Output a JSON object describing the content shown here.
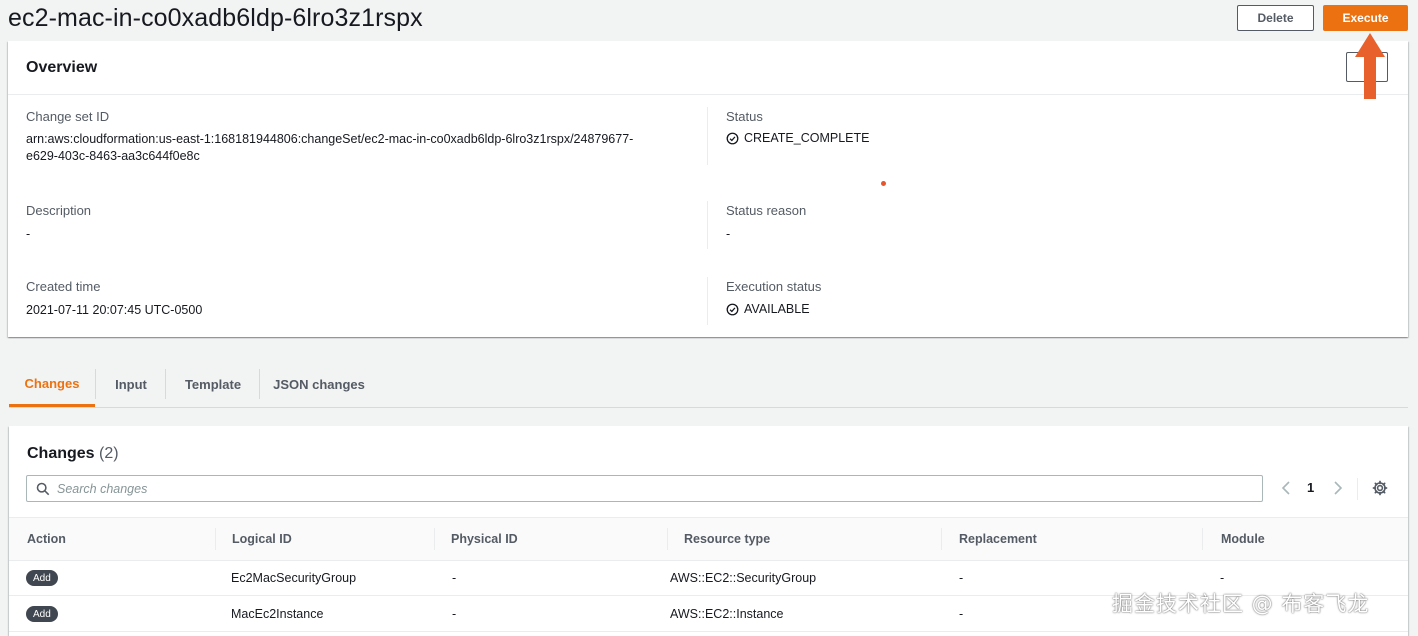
{
  "header": {
    "title": "ec2-mac-in-co0xadb6ldp-6lro3z1rspx",
    "delete_label": "Delete",
    "execute_label": "Execute"
  },
  "overview": {
    "title": "Overview",
    "change_set_id_label": "Change set ID",
    "change_set_id_value_line1": "arn:aws:cloudformation:us-east-1:168181944806:changeSet/ec2-mac-in-co0xadb6ldp-6lro3z1rspx/24879677-",
    "change_set_id_value_line2": "e629-403c-8463-aa3c644f0e8c",
    "description_label": "Description",
    "description_value": "-",
    "created_time_label": "Created time",
    "created_time_value": "2021-07-11 20:07:45 UTC-0500",
    "status_label": "Status",
    "status_value": "CREATE_COMPLETE",
    "status_reason_label": "Status reason",
    "status_reason_value": "-",
    "execution_status_label": "Execution status",
    "execution_status_value": "AVAILABLE"
  },
  "tabs": [
    {
      "label": "Changes",
      "active": true
    },
    {
      "label": "Input",
      "active": false
    },
    {
      "label": "Template",
      "active": false
    },
    {
      "label": "JSON changes",
      "active": false
    }
  ],
  "changes": {
    "title": "Changes",
    "count": "(2)",
    "search_placeholder": "Search changes",
    "page": "1",
    "columns": [
      "Action",
      "Logical ID",
      "Physical ID",
      "Resource type",
      "Replacement",
      "Module"
    ],
    "rows": [
      {
        "action": "Add",
        "logical_id": "Ec2MacSecurityGroup",
        "physical_id": "-",
        "resource_type": "AWS::EC2::SecurityGroup",
        "replacement": "-",
        "module": "-"
      },
      {
        "action": "Add",
        "logical_id": "MacEc2Instance",
        "physical_id": "-",
        "resource_type": "AWS::EC2::Instance",
        "replacement": "-",
        "module": ""
      }
    ]
  },
  "watermark": "掘金技术社区 @ 布客飞龙",
  "colors": {
    "accent": "#ec7211",
    "annotation_arrow": "#e8602c"
  },
  "icons": {
    "status": "check-circle-icon",
    "search": "search-icon",
    "prev": "chevron-left-icon",
    "next": "chevron-right-icon",
    "settings": "gear-icon",
    "annotation": "arrow-up-icon"
  }
}
